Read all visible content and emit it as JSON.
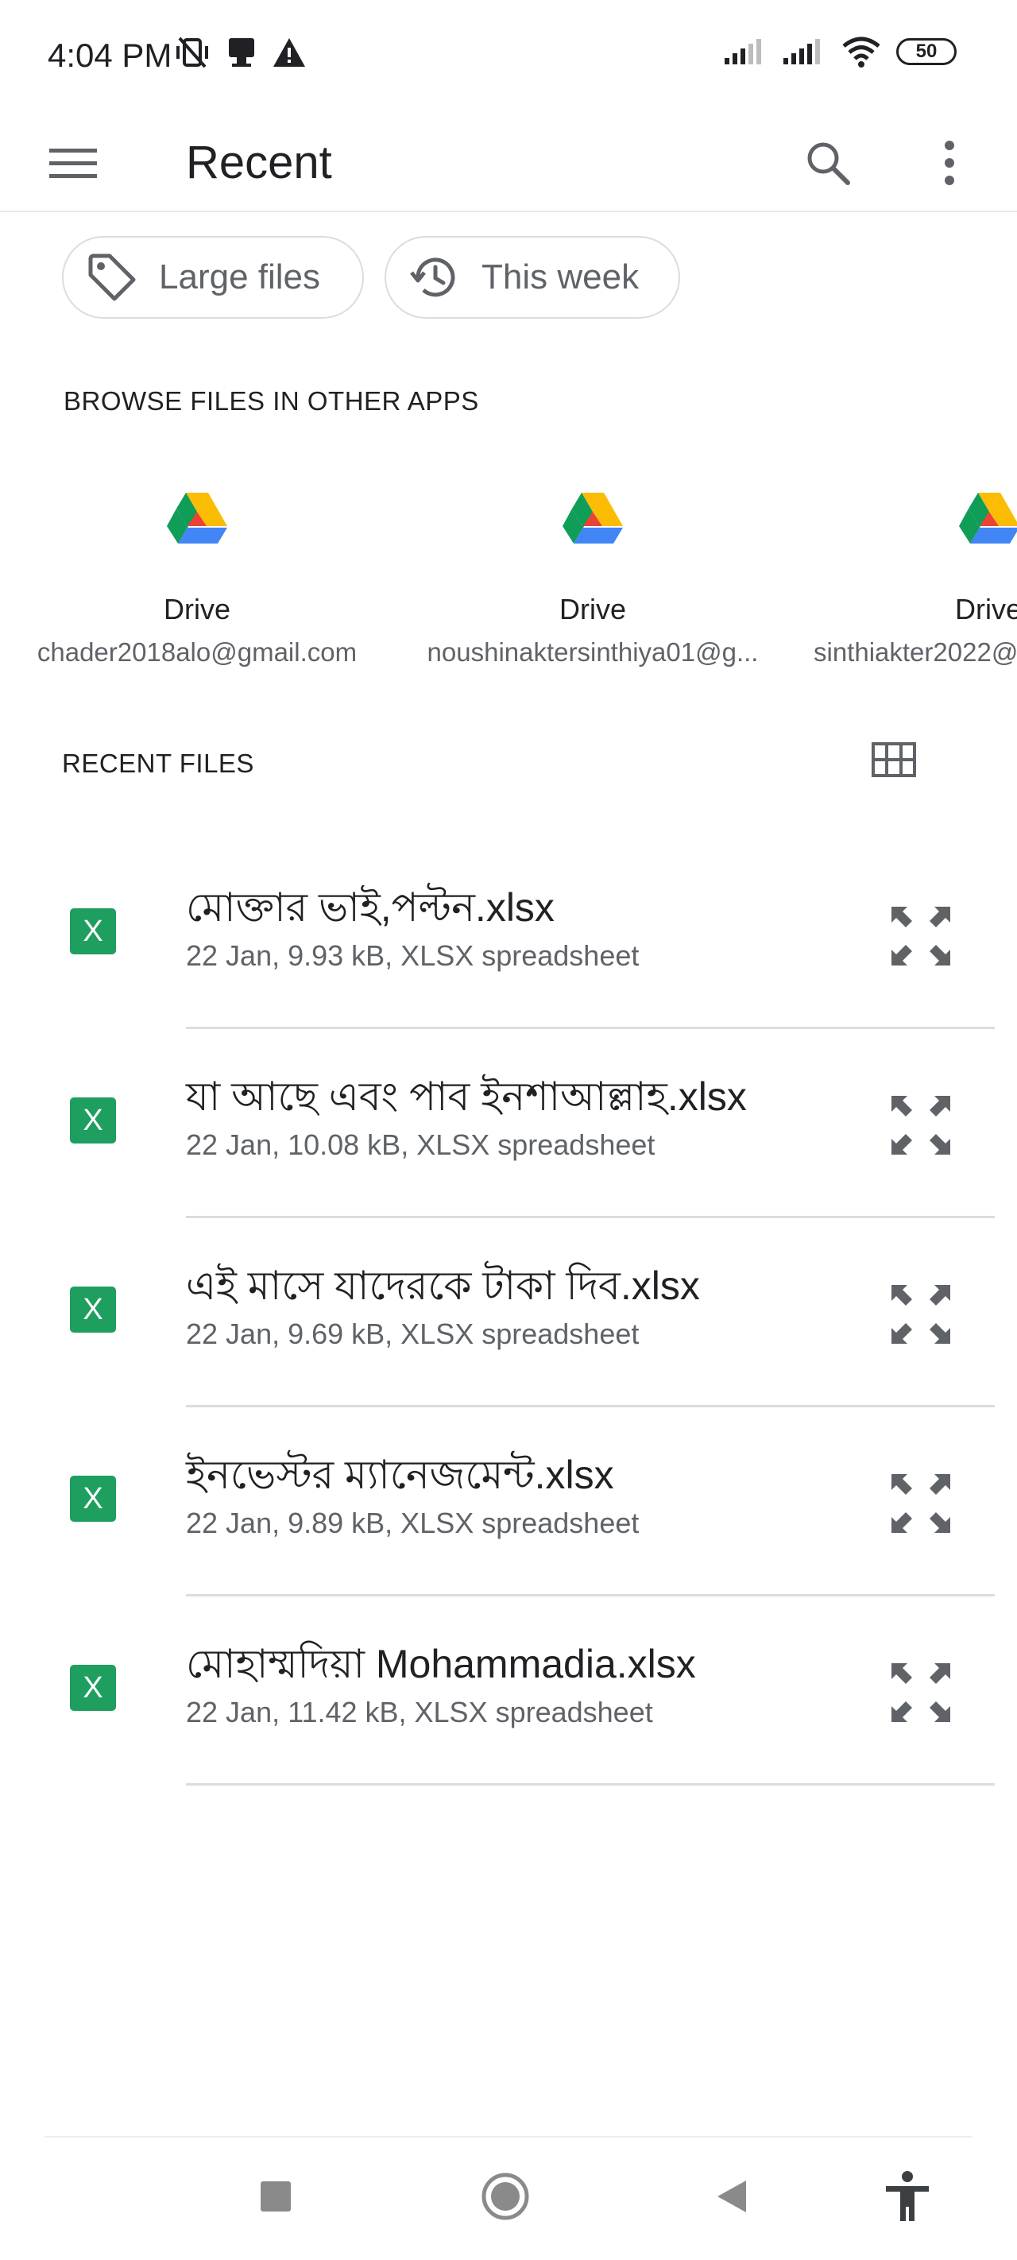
{
  "status_bar": {
    "time": "4:04 PM",
    "battery": "50",
    "left_icons": [
      "vibrate-off-icon",
      "notification-icon",
      "warning-icon"
    ],
    "right_icons": [
      "signal-icon",
      "signal-icon",
      "wifi-icon",
      "battery-icon"
    ]
  },
  "app_bar": {
    "title": "Recent",
    "icons": [
      "menu-icon",
      "search-icon",
      "more-vert-icon"
    ]
  },
  "chips": [
    {
      "label": "Large files",
      "icon": "tag-icon"
    },
    {
      "label": "This week",
      "icon": "history-icon"
    }
  ],
  "browse": {
    "heading": "BROWSE FILES IN OTHER APPS",
    "apps": [
      {
        "name": "Drive",
        "account": "chader2018alo@gmail.com"
      },
      {
        "name": "Drive",
        "account": "noushinaktersinthiya01@g..."
      },
      {
        "name": "Drive",
        "account": "sinthiakter2022@"
      }
    ]
  },
  "recent": {
    "heading": "RECENT FILES",
    "view_toggle_icon": "grid-view-icon",
    "files": [
      {
        "name": "মোক্তার ভাই,পল্টন.xlsx",
        "meta": "22 Jan, 9.93 kB, XLSX spreadsheet",
        "icon_letter": "X"
      },
      {
        "name": "যা আছে এবং পাব ইনশাআল্লাহ.xlsx",
        "meta": "22 Jan, 10.08 kB, XLSX spreadsheet",
        "icon_letter": "X"
      },
      {
        "name": "এই মাসে যাদেরকে টাকা দিব.xlsx",
        "meta": "22 Jan, 9.69 kB, XLSX spreadsheet",
        "icon_letter": "X"
      },
      {
        "name": "ইনভেস্টর ম্যানেজমেন্ট.xlsx",
        "meta": "22 Jan, 9.89 kB, XLSX spreadsheet",
        "icon_letter": "X"
      },
      {
        "name": "মোহাম্মদিয়া Mohammadia.xlsx",
        "meta": "22 Jan, 11.42 kB, XLSX spreadsheet",
        "icon_letter": "X"
      }
    ]
  },
  "nav_bar": {
    "icons": [
      "recents-square-icon",
      "home-circle-icon",
      "back-triangle-icon",
      "accessibility-icon"
    ]
  },
  "colors": {
    "xlsx_green": "#1e9e5f",
    "text_primary": "#202124",
    "text_secondary": "#5f6368",
    "divider": "#dadce0"
  }
}
